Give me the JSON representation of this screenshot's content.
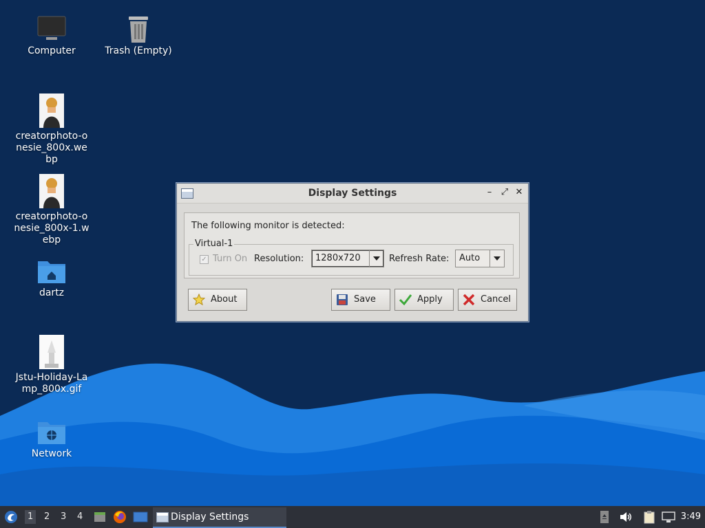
{
  "desktop": {
    "icons": [
      {
        "label": "Computer",
        "icon": "computer-icon"
      },
      {
        "label": "Trash (Empty)",
        "icon": "trash-icon"
      },
      {
        "label": "creatorphoto-onesie_800x.webp",
        "icon": "image-thumbnail-icon"
      },
      {
        "label": "creatorphoto-onesie_800x-1.webp",
        "icon": "image-thumbnail-icon"
      },
      {
        "label": "dartz",
        "icon": "home-folder-icon"
      },
      {
        "label": "Jstu-Holiday-Lamp_800x.gif",
        "icon": "image-thumbnail-icon"
      },
      {
        "label": "Network",
        "icon": "network-folder-icon"
      }
    ]
  },
  "dialog": {
    "title": "Display Settings",
    "detected_text": "The following monitor is detected:",
    "monitor": {
      "name": "Virtual-1",
      "turn_on_label": "Turn On",
      "turn_on_checked": true,
      "resolution_label": "Resolution:",
      "resolution_value": "1280x720",
      "refresh_label": "Refresh Rate:",
      "refresh_value": "Auto"
    },
    "buttons": {
      "about": "About",
      "save": "Save",
      "apply": "Apply",
      "cancel": "Cancel"
    }
  },
  "taskbar": {
    "workspaces": [
      "1",
      "2",
      "3",
      "4"
    ],
    "active_workspace": "1",
    "task_title": "Display Settings",
    "clock": "3:49"
  },
  "colors": {
    "desktop_bg": "#0b2a55",
    "wave_light": "#2e8be6",
    "wave_dark": "#0a63c9",
    "dialog_bg": "#dad9d6",
    "taskbar_bg": "#2d3038"
  }
}
